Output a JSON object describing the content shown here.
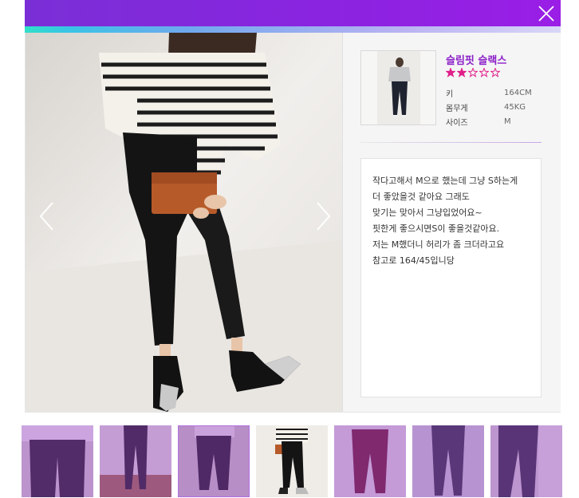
{
  "colors": {
    "header": "#8a24e0",
    "accent": "#8b1fc7",
    "star": "#e0208a"
  },
  "header": {
    "close_icon": "close-icon"
  },
  "gallery": {
    "prev_icon": "chevron-left-icon",
    "next_icon": "chevron-right-icon"
  },
  "product": {
    "name": "슬림핏 슬랙스",
    "rating": 2,
    "rating_max": 5,
    "specs": [
      {
        "label": "키",
        "value": "164CM"
      },
      {
        "label": "몸무게",
        "value": "45KG"
      },
      {
        "label": "사이즈",
        "value": "M"
      }
    ]
  },
  "review": {
    "lines": [
      "작다고해서 M으로 했는데 그냥 S하는게",
      "더 좋았을것 같아요 그래도",
      "맞기는 맞아서 그냥입었어요~",
      "핏한게 좋으시면S이 좋을것같아요.",
      "저는 M했더니 허리가 좀 크더라고요",
      "참고로 164/45입니당"
    ]
  },
  "thumbnails": {
    "count": 7,
    "selected_index": 3
  }
}
